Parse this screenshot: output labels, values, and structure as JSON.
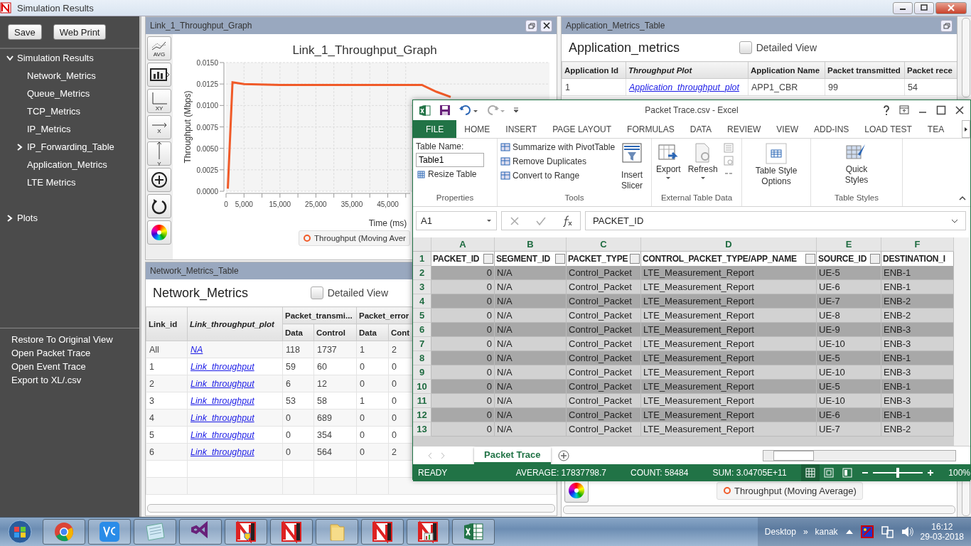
{
  "window": {
    "title": "Simulation Results"
  },
  "sidebar": {
    "buttons": [
      "Save",
      "Web Print"
    ],
    "tree": [
      {
        "label": "Simulation Results",
        "expanded": true,
        "children": [
          {
            "label": "Network_Metrics"
          },
          {
            "label": "Queue_Metrics"
          },
          {
            "label": "TCP_Metrics"
          },
          {
            "label": "IP_Metrics"
          },
          {
            "label": "IP_Forwarding_Table",
            "expanded": false
          },
          {
            "label": "Application_Metrics"
          },
          {
            "label": "LTE Metrics"
          }
        ]
      },
      {
        "label": "Plots",
        "expanded": false
      }
    ],
    "actions": [
      "Restore To Original View",
      "Open Packet Trace",
      "Open Event Trace",
      "Export to XL/.csv"
    ]
  },
  "graph_panel": {
    "title": "Link_1_Throughput_Graph",
    "tools": [
      {
        "kind": "avg",
        "label": "AVG"
      },
      {
        "kind": "bars"
      },
      {
        "kind": "xy",
        "label": "XY"
      },
      {
        "kind": "x",
        "label": "X"
      },
      {
        "kind": "y",
        "label": "Y"
      },
      {
        "kind": "zoom"
      },
      {
        "kind": "reset"
      },
      {
        "kind": "color"
      }
    ],
    "chart_data": {
      "type": "line",
      "title": "Link_1_Throughput_Graph",
      "xlabel": "Time (ms)",
      "ylabel": "Throughput (Mbps)",
      "x": [
        500,
        1800,
        5000,
        15000,
        30000,
        54500,
        58500,
        62500
      ],
      "grid": true,
      "series": [
        {
          "name": "Throughput (Moving Aver",
          "color": "#f05a28",
          "values": [
            0.0003,
            0.0127,
            0.0125,
            0.0124,
            0.0124,
            0.0124,
            0.0116,
            0.011
          ]
        }
      ],
      "xlim": [
        0,
        90000
      ],
      "ylim": [
        0,
        0.015
      ],
      "xticks": [
        {
          "value": 0,
          "label": "0"
        },
        {
          "value": 5000,
          "label": "5,000"
        },
        {
          "value": 15000,
          "label": "15,000"
        },
        {
          "value": 25000,
          "label": "25,000"
        },
        {
          "value": 35000,
          "label": "35,000"
        },
        {
          "value": 45000,
          "label": "45,000"
        }
      ],
      "yticks": [
        {
          "value": 0,
          "label": "0.0000"
        },
        {
          "value": 0.0025,
          "label": "0.0025"
        },
        {
          "value": 0.005,
          "label": "0.0050"
        },
        {
          "value": 0.0075,
          "label": "0.0075"
        },
        {
          "value": 0.01,
          "label": "0.0100"
        },
        {
          "value": 0.0125,
          "label": "0.0125"
        },
        {
          "value": 0.015,
          "label": "0.0150"
        }
      ]
    }
  },
  "network_panel": {
    "title": "Network_Metrics_Table",
    "heading": "Network_Metrics",
    "detailed_view": {
      "label": "Detailed View",
      "checked": false
    },
    "columns": [
      "Link_id",
      "Link_throughput_plot"
    ],
    "groups": [
      {
        "label": "Packet_transmi...",
        "sub": [
          "Data",
          "Control"
        ]
      },
      {
        "label": "Packet_error",
        "sub": [
          "Data",
          "Cont"
        ]
      }
    ],
    "rows": [
      [
        "All",
        "NA",
        "118",
        "1737",
        "1",
        "2"
      ],
      [
        "1",
        "Link_throughput",
        "59",
        "60",
        "0",
        "0"
      ],
      [
        "2",
        "Link_throughput",
        "6",
        "12",
        "0",
        "0"
      ],
      [
        "3",
        "Link_throughput",
        "53",
        "58",
        "1",
        "0"
      ],
      [
        "4",
        "Link_throughput",
        "0",
        "689",
        "0",
        "0"
      ],
      [
        "5",
        "Link_throughput",
        "0",
        "354",
        "0",
        "0"
      ],
      [
        "6",
        "Link_throughput",
        "0",
        "564",
        "0",
        "2"
      ]
    ]
  },
  "app_panel": {
    "title": "Application_Metrics_Table",
    "heading": "Application_metrics",
    "detailed_view": {
      "label": "Detailed View",
      "checked": false
    },
    "columns": [
      "Application Id",
      "Throughput Plot",
      "Application Name",
      "Packet transmitted",
      "Packet rece"
    ],
    "rows": [
      [
        "1",
        "Application_throughput_plot",
        "APP1_CBR",
        "99",
        "54"
      ]
    ],
    "legend": "Throughput (Moving Average)"
  },
  "excel": {
    "title": "Packet Trace.csv - Excel",
    "tabs": [
      {
        "label": "FILE",
        "selected": true
      },
      {
        "label": "HOME",
        "selected": false
      },
      {
        "label": "INSERT",
        "selected": false
      },
      {
        "label": "PAGE LAYOUT",
        "selected": false
      },
      {
        "label": "FORMULAS",
        "selected": false
      },
      {
        "label": "DATA",
        "selected": false
      },
      {
        "label": "REVIEW",
        "selected": false
      },
      {
        "label": "VIEW",
        "selected": false
      },
      {
        "label": "ADD-INS",
        "selected": false
      },
      {
        "label": "LOAD TEST",
        "selected": false
      },
      {
        "label": "TEA",
        "selected": false
      }
    ],
    "ribbon": {
      "table_name_label": "Table Name:",
      "table_name": "Table1",
      "resize": "Resize Table",
      "properties": "Properties",
      "tools": [
        "Summarize with PivotTable",
        "Remove Duplicates",
        "Convert to Range"
      ],
      "slicer": "Insert Slicer",
      "tools_label": "Tools",
      "export": "Export",
      "refresh": "Refresh",
      "external_label": "External Table Data",
      "style_options": "Table Style Options",
      "quick_styles": "Quick Styles",
      "styles_label": "Table Styles"
    },
    "name_box": "A1",
    "formula": "PACKET_ID",
    "columns": [
      "A",
      "B",
      "C",
      "D",
      "E",
      "F"
    ],
    "headers": [
      "PACKET_ID",
      "SEGMENT_ID",
      "PACKET_TYPE",
      "CONTROL_PACKET_TYPE/APP_NAME",
      "SOURCE_ID",
      "DESTINATION_I"
    ],
    "header_row_number": "1",
    "rows": [
      {
        "number": "2",
        "cells": [
          "0",
          "N/A",
          "Control_Packet",
          "LTE_Measurement_Report",
          "UE-5",
          "ENB-1"
        ]
      },
      {
        "number": "3",
        "cells": [
          "0",
          "N/A",
          "Control_Packet",
          "LTE_Measurement_Report",
          "UE-6",
          "ENB-1"
        ]
      },
      {
        "number": "4",
        "cells": [
          "0",
          "N/A",
          "Control_Packet",
          "LTE_Measurement_Report",
          "UE-7",
          "ENB-2"
        ]
      },
      {
        "number": "5",
        "cells": [
          "0",
          "N/A",
          "Control_Packet",
          "LTE_Measurement_Report",
          "UE-8",
          "ENB-2"
        ]
      },
      {
        "number": "6",
        "cells": [
          "0",
          "N/A",
          "Control_Packet",
          "LTE_Measurement_Report",
          "UE-9",
          "ENB-3"
        ]
      },
      {
        "number": "7",
        "cells": [
          "0",
          "N/A",
          "Control_Packet",
          "LTE_Measurement_Report",
          "UE-10",
          "ENB-3"
        ]
      },
      {
        "number": "8",
        "cells": [
          "0",
          "N/A",
          "Control_Packet",
          "LTE_Measurement_Report",
          "UE-5",
          "ENB-1"
        ]
      },
      {
        "number": "9",
        "cells": [
          "0",
          "N/A",
          "Control_Packet",
          "LTE_Measurement_Report",
          "UE-10",
          "ENB-3"
        ]
      },
      {
        "number": "10",
        "cells": [
          "0",
          "N/A",
          "Control_Packet",
          "LTE_Measurement_Report",
          "UE-5",
          "ENB-1"
        ]
      },
      {
        "number": "11",
        "cells": [
          "0",
          "N/A",
          "Control_Packet",
          "LTE_Measurement_Report",
          "UE-10",
          "ENB-3"
        ]
      },
      {
        "number": "12",
        "cells": [
          "0",
          "N/A",
          "Control_Packet",
          "LTE_Measurement_Report",
          "UE-6",
          "ENB-1"
        ]
      },
      {
        "number": "13",
        "cells": [
          "0",
          "N/A",
          "Control_Packet",
          "LTE_Measurement_Report",
          "UE-7",
          "ENB-2"
        ]
      }
    ],
    "sheet_tabs": [
      {
        "label": "Packet Trace",
        "selected": true
      }
    ],
    "status": {
      "mode": "READY",
      "average": "AVERAGE: 17837798.7",
      "count": "COUNT: 58484",
      "sum": "SUM: 3.04705E+11",
      "zoom": {
        "level": 0.5
      },
      "zoom_label": "100%"
    }
  },
  "taskbar": {
    "desktop": "Desktop",
    "chevron": "»",
    "user": "kanak",
    "time": "16:12",
    "date": "29-03-2018"
  }
}
